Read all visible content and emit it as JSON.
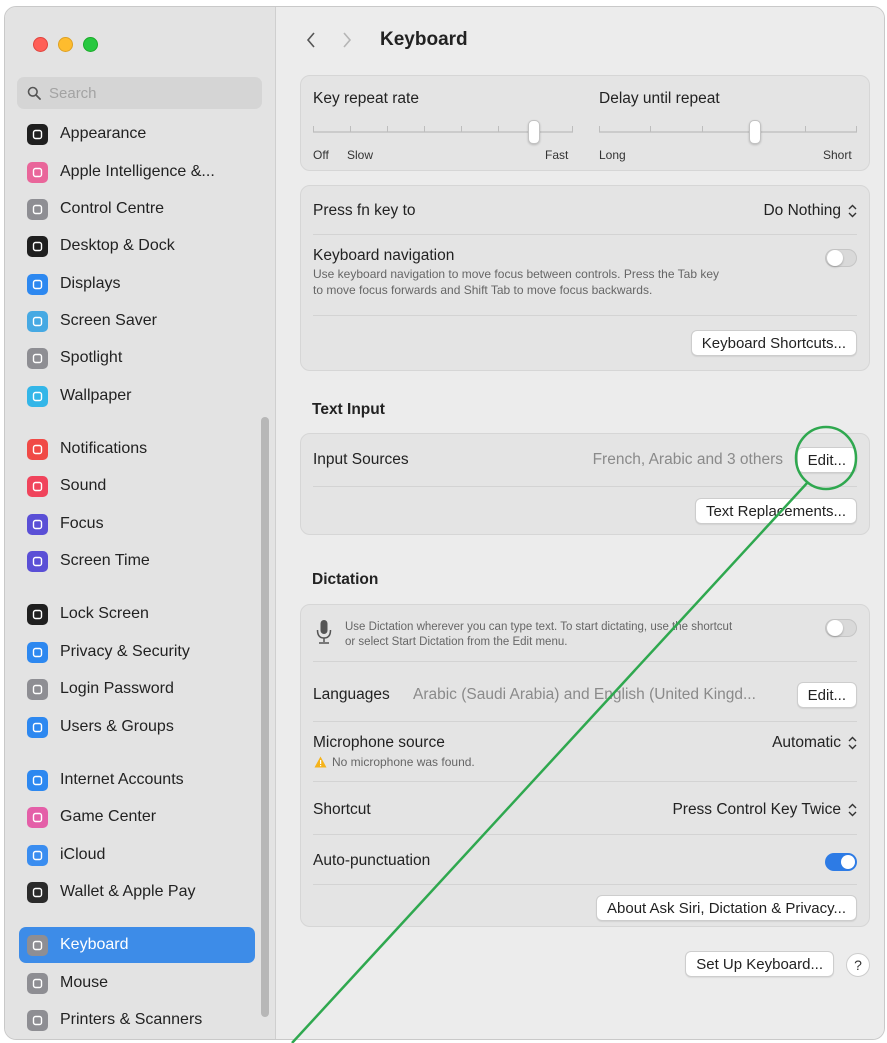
{
  "window": {
    "title": "Keyboard"
  },
  "search": {
    "placeholder": "Search"
  },
  "sidebar": {
    "items": [
      {
        "label": "Appearance",
        "icon": "appearance-icon",
        "color": "#1f1f1f"
      },
      {
        "label": "Apple Intelligence &...",
        "icon": "apple-intelligence-icon",
        "color": "#e9669a"
      },
      {
        "label": "Control Centre",
        "icon": "control-centre-icon",
        "color": "#8e8e93"
      },
      {
        "label": "Desktop & Dock",
        "icon": "desktop-dock-icon",
        "color": "#1f1f1f"
      },
      {
        "label": "Displays",
        "icon": "displays-icon",
        "color": "#2d88f0"
      },
      {
        "label": "Screen Saver",
        "icon": "screen-saver-icon",
        "color": "#46a9e3"
      },
      {
        "label": "Spotlight",
        "icon": "spotlight-icon",
        "color": "#8e8e93"
      },
      {
        "label": "Wallpaper",
        "icon": "wallpaper-icon",
        "color": "#33b6e8"
      },
      {
        "label": "Notifications",
        "icon": "notifications-icon",
        "color": "#f04a46"
      },
      {
        "label": "Sound",
        "icon": "sound-icon",
        "color": "#f0445c"
      },
      {
        "label": "Focus",
        "icon": "focus-icon",
        "color": "#5a4fd6"
      },
      {
        "label": "Screen Time",
        "icon": "screen-time-icon",
        "color": "#5a4fd6"
      },
      {
        "label": "Lock Screen",
        "icon": "lock-screen-icon",
        "color": "#1f1f1f"
      },
      {
        "label": "Privacy & Security",
        "icon": "privacy-security-icon",
        "color": "#2d88f0"
      },
      {
        "label": "Login Password",
        "icon": "login-password-icon",
        "color": "#8e8e93"
      },
      {
        "label": "Users & Groups",
        "icon": "users-groups-icon",
        "color": "#2d88f0"
      },
      {
        "label": "Internet Accounts",
        "icon": "internet-accounts-icon",
        "color": "#2d88f0"
      },
      {
        "label": "Game Center",
        "icon": "game-center-icon",
        "color": "#e45fa8"
      },
      {
        "label": "iCloud",
        "icon": "icloud-icon",
        "color": "#3a8df0"
      },
      {
        "label": "Wallet & Apple Pay",
        "icon": "wallet-icon",
        "color": "#2b2b2b"
      },
      {
        "label": "Keyboard",
        "icon": "keyboard-icon",
        "color": "#8e8e93",
        "selected": true
      },
      {
        "label": "Mouse",
        "icon": "mouse-icon",
        "color": "#8e8e93"
      },
      {
        "label": "Printers & Scanners",
        "icon": "printers-scanners-icon",
        "color": "#8e8e93"
      }
    ]
  },
  "repeat": {
    "key_repeat_label": "Key repeat rate",
    "delay_label": "Delay until repeat",
    "off": "Off",
    "slow": "Slow",
    "fast": "Fast",
    "long": "Long",
    "short": "Short"
  },
  "keyboard_settings": {
    "fn_label": "Press fn key to",
    "fn_value": "Do Nothing",
    "nav_label": "Keyboard navigation",
    "nav_desc_1": "Use keyboard navigation to move focus between controls. Press the Tab key",
    "nav_desc_2": "to move focus forwards and Shift Tab to move focus backwards.",
    "nav_enabled": false,
    "shortcuts_button": "Keyboard Shortcuts..."
  },
  "text_input": {
    "heading": "Text Input",
    "sources_label": "Input Sources",
    "sources_value": "French, Arabic and 3 others",
    "edit_button": "Edit...",
    "replacements_button": "Text Replacements..."
  },
  "dictation": {
    "heading": "Dictation",
    "desc_1": "Use Dictation wherever you can type text. To start dictating, use the shortcut",
    "desc_2": "or select Start Dictation from the Edit menu.",
    "enabled": false,
    "languages_label": "Languages",
    "languages_value": "Arabic (Saudi Arabia) and English (United Kingd...",
    "languages_edit": "Edit...",
    "mic_label": "Microphone source",
    "mic_value": "Automatic",
    "mic_warning": "No microphone was found.",
    "shortcut_label": "Shortcut",
    "shortcut_value": "Press Control Key Twice",
    "autopunct_label": "Auto-punctuation",
    "autopunct_enabled": true,
    "about_button": "About Ask Siri, Dictation & Privacy..."
  },
  "footer": {
    "setup_button": "Set Up Keyboard...",
    "help": "?"
  },
  "annotation_color": "#2fa84f"
}
